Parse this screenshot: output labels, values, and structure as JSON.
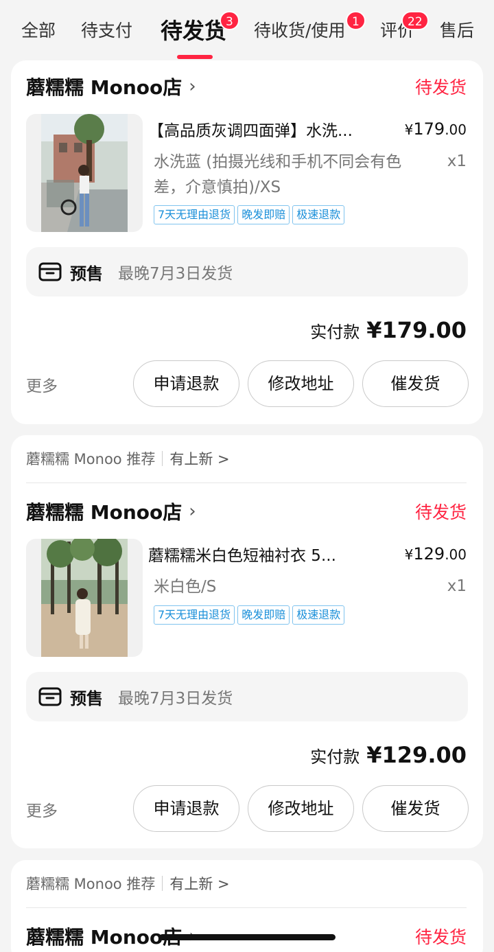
{
  "tabs": [
    {
      "label": "全部"
    },
    {
      "label": "待支付"
    },
    {
      "label": "待发货",
      "badge": "3",
      "active": true
    },
    {
      "label": "待收货/使用",
      "badge": "1"
    },
    {
      "label": "评价",
      "badge": "22"
    },
    {
      "label": "售后"
    }
  ],
  "orders": [
    {
      "shop": "蘑糯糯 Monoo店",
      "status": "待发货",
      "title": "【高品质灰调四面弹】水洗...",
      "price_cur": "¥",
      "price_int": "179",
      "price_dec": ".00",
      "spec": "水洗蓝 (拍摄光线和手机不同会有色差，介意慎拍)/XS",
      "qty": "x1",
      "tags": [
        "7天无理由退货",
        "晚发即赔",
        "极速退款"
      ],
      "presale_label": "预售",
      "presale_info": "最晚7月3日发货",
      "paid_label": "实付款",
      "paid_amount": "¥179.00",
      "more": "更多",
      "actions": [
        "申请退款",
        "修改地址",
        "催发货"
      ]
    },
    {
      "recommend": "蘑糯糯 Monoo 推荐",
      "new_label": "有上新 >",
      "shop": "蘑糯糯 Monoo店",
      "status": "待发货",
      "title": "蘑糯糯米白色短袖衬衣 5...",
      "price_cur": "¥",
      "price_int": "129",
      "price_dec": ".00",
      "spec": "米白色/S",
      "qty": "x1",
      "tags": [
        "7天无理由退货",
        "晚发即赔",
        "极速退款"
      ],
      "presale_label": "预售",
      "presale_info": "最晚7月3日发货",
      "paid_label": "实付款",
      "paid_amount": "¥129.00",
      "more": "更多",
      "actions": [
        "申请退款",
        "修改地址",
        "催发货"
      ]
    },
    {
      "recommend": "蘑糯糯 Monoo 推荐",
      "new_label": "有上新 >",
      "shop": "蘑糯糯 Monoo店",
      "status": "待发货"
    }
  ],
  "colors": {
    "accent": "#ff2442",
    "tag_blue": "#1a8fd9"
  }
}
